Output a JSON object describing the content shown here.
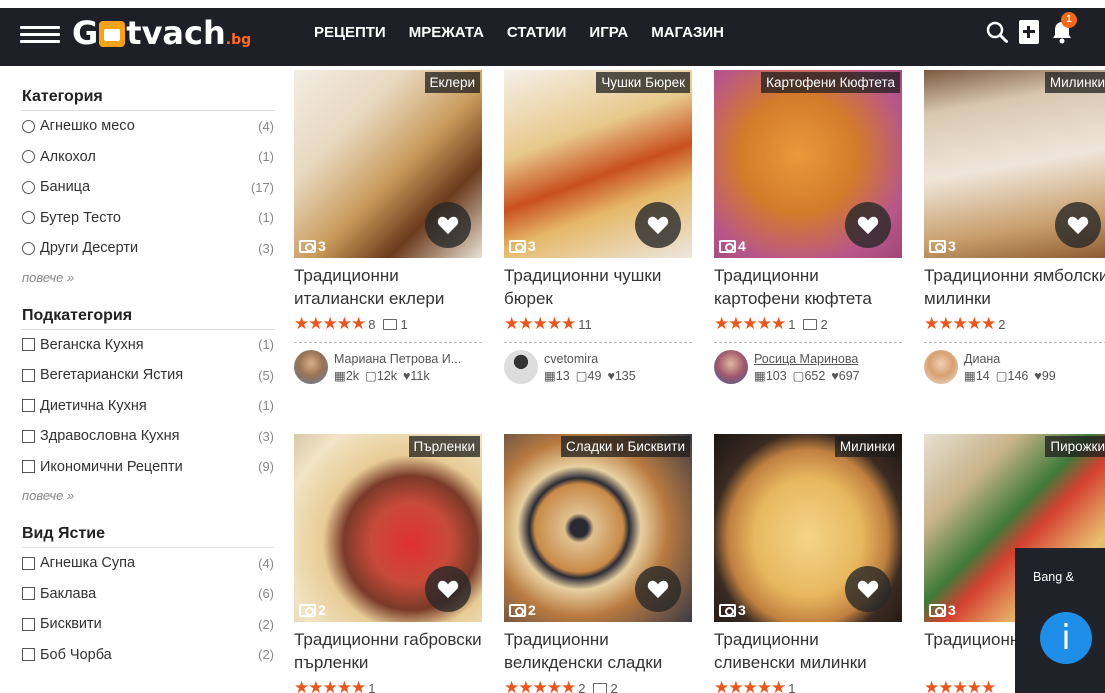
{
  "header": {
    "logo_main": "Gtvach",
    "logo_suffix": ".bg",
    "nav": [
      "РЕЦЕПТИ",
      "МРЕЖАТА",
      "СТАТИИ",
      "ИГРА",
      "МАГАЗИН"
    ],
    "notifications": "1"
  },
  "sidebar": {
    "category": {
      "title": "Категория",
      "items": [
        {
          "label": "Агнешко месо",
          "count": "(4)"
        },
        {
          "label": "Алкохол",
          "count": "(1)"
        },
        {
          "label": "Баница",
          "count": "(17)"
        },
        {
          "label": "Бутер Тесто",
          "count": "(1)"
        },
        {
          "label": "Други Десерти",
          "count": "(3)"
        }
      ],
      "more": "повече »"
    },
    "subcategory": {
      "title": "Подкатегория",
      "items": [
        {
          "label": "Веганска Кухня",
          "count": "(1)"
        },
        {
          "label": "Вегетариански Ястия",
          "count": "(5)"
        },
        {
          "label": "Диетична Кухня",
          "count": "(1)"
        },
        {
          "label": "Здравословна Кухня",
          "count": "(3)"
        },
        {
          "label": "Икономични Рецепти",
          "count": "(9)"
        }
      ],
      "more": "повече »"
    },
    "dish": {
      "title": "Вид Ястие",
      "items": [
        {
          "label": "Агнешка Супа",
          "count": "(4)"
        },
        {
          "label": "Баклава",
          "count": "(6)"
        },
        {
          "label": "Бисквити",
          "count": "(2)"
        },
        {
          "label": "Боб Чорба",
          "count": "(2)"
        }
      ]
    }
  },
  "recipes": [
    {
      "tag": "Еклери",
      "photos": "3",
      "title": "Традиционни италиански еклери",
      "stars": "★★★★★",
      "votes": "8",
      "comments": "1",
      "author": "Мариана Петрова И...",
      "recipes_count": "2k",
      "followers": "12k",
      "likes": "11k"
    },
    {
      "tag": "Чушки Бюрек",
      "photos": "3",
      "title": "Традиционни чушки бюрек",
      "stars": "★★★★★",
      "votes": "11",
      "comments": "",
      "author": "cvetomira",
      "recipes_count": "13",
      "followers": "49",
      "likes": "135"
    },
    {
      "tag": "Картофени Кюфтета",
      "photos": "4",
      "title": "Традиционни картофени кюфтета",
      "stars": "★★★★★",
      "votes": "1",
      "comments": "2",
      "author": "Росица Маринова",
      "recipes_count": "103",
      "followers": "652",
      "likes": "697"
    },
    {
      "tag": "Милинки",
      "photos": "3",
      "title": "Традиционни ямболски милинки",
      "stars": "★★★★★",
      "votes": "2",
      "comments": "",
      "author": "Диана",
      "recipes_count": "14",
      "followers": "146",
      "likes": "99"
    },
    {
      "tag": "Пърленки",
      "photos": "2",
      "title": "Традиционни габровски пърленки",
      "stars": "★★★★★",
      "votes": "1",
      "comments": ""
    },
    {
      "tag": "Сладки и Бисквити",
      "photos": "2",
      "title": "Традиционни великденски сладки",
      "stars": "★★★★★",
      "votes": "2",
      "comments": "2"
    },
    {
      "tag": "Милинки",
      "photos": "3",
      "title": "Традиционни сливенски милинки",
      "stars": "★★★★★",
      "votes": "1",
      "comments": ""
    },
    {
      "tag": "Пирожки",
      "photos": "3",
      "title": "Традиционни пирожки",
      "stars": "★★★★★",
      "votes": "",
      "comments": ""
    }
  ],
  "widget": {
    "text": "Bang &",
    "info": "i"
  }
}
